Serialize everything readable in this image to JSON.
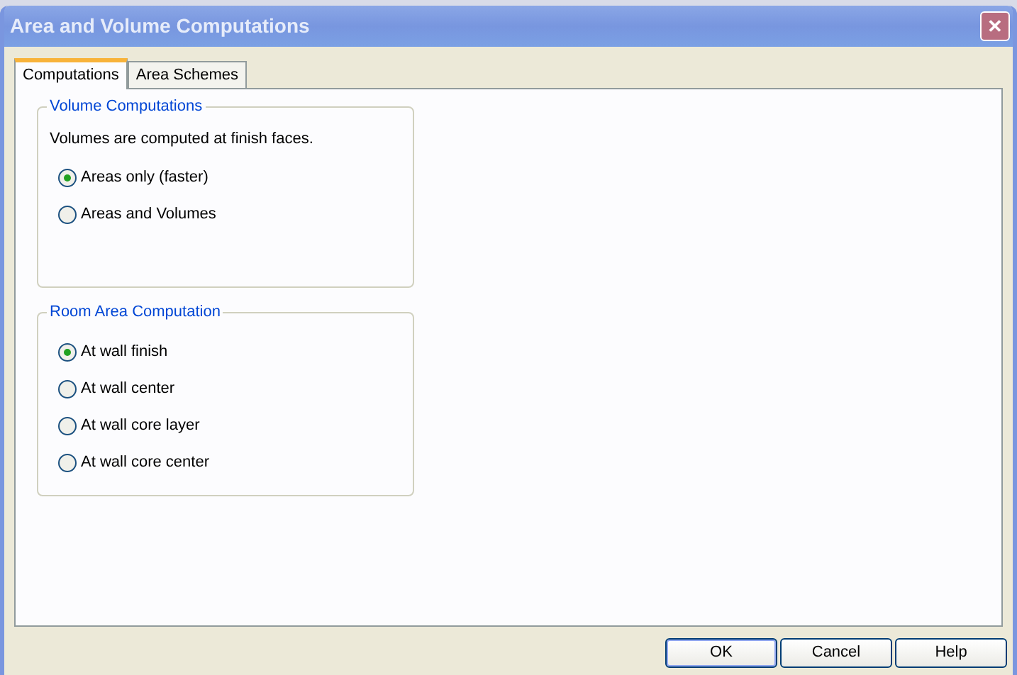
{
  "window": {
    "title": "Area and Volume Computations",
    "close": "✕"
  },
  "tabs": [
    {
      "label": "Computations",
      "selected": true
    },
    {
      "label": "Area Schemes",
      "selected": false
    }
  ],
  "groups": [
    {
      "title": "Volume Computations",
      "note": "Volumes are computed at finish faces.",
      "options": [
        {
          "label": "Areas only (faster)",
          "selected": true
        },
        {
          "label": "Areas and Volumes",
          "selected": false
        }
      ]
    },
    {
      "title": "Room Area Computation",
      "options": [
        {
          "label": "At wall finish",
          "selected": true
        },
        {
          "label": "At wall center",
          "selected": false
        },
        {
          "label": "At wall core layer",
          "selected": false
        },
        {
          "label": "At wall core center",
          "selected": false
        }
      ]
    }
  ],
  "buttons": [
    {
      "label": "OK",
      "default": true
    },
    {
      "label": "Cancel",
      "default": false
    },
    {
      "label": "Help",
      "default": false
    }
  ]
}
